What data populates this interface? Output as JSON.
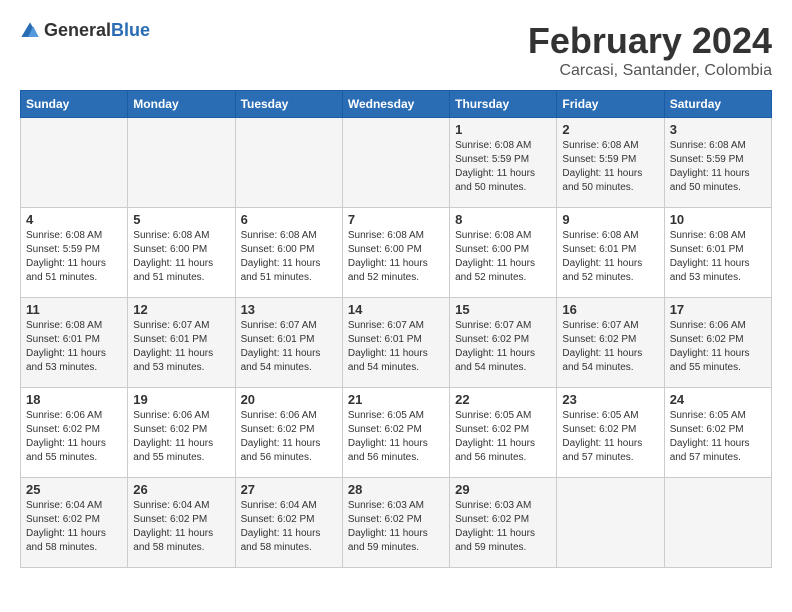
{
  "logo": {
    "general": "General",
    "blue": "Blue"
  },
  "header": {
    "month": "February 2024",
    "location": "Carcasi, Santander, Colombia"
  },
  "weekdays": [
    "Sunday",
    "Monday",
    "Tuesday",
    "Wednesday",
    "Thursday",
    "Friday",
    "Saturday"
  ],
  "weeks": [
    [
      {
        "day": "",
        "info": ""
      },
      {
        "day": "",
        "info": ""
      },
      {
        "day": "",
        "info": ""
      },
      {
        "day": "",
        "info": ""
      },
      {
        "day": "1",
        "info": "Sunrise: 6:08 AM\nSunset: 5:59 PM\nDaylight: 11 hours and 50 minutes."
      },
      {
        "day": "2",
        "info": "Sunrise: 6:08 AM\nSunset: 5:59 PM\nDaylight: 11 hours and 50 minutes."
      },
      {
        "day": "3",
        "info": "Sunrise: 6:08 AM\nSunset: 5:59 PM\nDaylight: 11 hours and 50 minutes."
      }
    ],
    [
      {
        "day": "4",
        "info": "Sunrise: 6:08 AM\nSunset: 5:59 PM\nDaylight: 11 hours and 51 minutes."
      },
      {
        "day": "5",
        "info": "Sunrise: 6:08 AM\nSunset: 6:00 PM\nDaylight: 11 hours and 51 minutes."
      },
      {
        "day": "6",
        "info": "Sunrise: 6:08 AM\nSunset: 6:00 PM\nDaylight: 11 hours and 51 minutes."
      },
      {
        "day": "7",
        "info": "Sunrise: 6:08 AM\nSunset: 6:00 PM\nDaylight: 11 hours and 52 minutes."
      },
      {
        "day": "8",
        "info": "Sunrise: 6:08 AM\nSunset: 6:00 PM\nDaylight: 11 hours and 52 minutes."
      },
      {
        "day": "9",
        "info": "Sunrise: 6:08 AM\nSunset: 6:01 PM\nDaylight: 11 hours and 52 minutes."
      },
      {
        "day": "10",
        "info": "Sunrise: 6:08 AM\nSunset: 6:01 PM\nDaylight: 11 hours and 53 minutes."
      }
    ],
    [
      {
        "day": "11",
        "info": "Sunrise: 6:08 AM\nSunset: 6:01 PM\nDaylight: 11 hours and 53 minutes."
      },
      {
        "day": "12",
        "info": "Sunrise: 6:07 AM\nSunset: 6:01 PM\nDaylight: 11 hours and 53 minutes."
      },
      {
        "day": "13",
        "info": "Sunrise: 6:07 AM\nSunset: 6:01 PM\nDaylight: 11 hours and 54 minutes."
      },
      {
        "day": "14",
        "info": "Sunrise: 6:07 AM\nSunset: 6:01 PM\nDaylight: 11 hours and 54 minutes."
      },
      {
        "day": "15",
        "info": "Sunrise: 6:07 AM\nSunset: 6:02 PM\nDaylight: 11 hours and 54 minutes."
      },
      {
        "day": "16",
        "info": "Sunrise: 6:07 AM\nSunset: 6:02 PM\nDaylight: 11 hours and 54 minutes."
      },
      {
        "day": "17",
        "info": "Sunrise: 6:06 AM\nSunset: 6:02 PM\nDaylight: 11 hours and 55 minutes."
      }
    ],
    [
      {
        "day": "18",
        "info": "Sunrise: 6:06 AM\nSunset: 6:02 PM\nDaylight: 11 hours and 55 minutes."
      },
      {
        "day": "19",
        "info": "Sunrise: 6:06 AM\nSunset: 6:02 PM\nDaylight: 11 hours and 55 minutes."
      },
      {
        "day": "20",
        "info": "Sunrise: 6:06 AM\nSunset: 6:02 PM\nDaylight: 11 hours and 56 minutes."
      },
      {
        "day": "21",
        "info": "Sunrise: 6:05 AM\nSunset: 6:02 PM\nDaylight: 11 hours and 56 minutes."
      },
      {
        "day": "22",
        "info": "Sunrise: 6:05 AM\nSunset: 6:02 PM\nDaylight: 11 hours and 56 minutes."
      },
      {
        "day": "23",
        "info": "Sunrise: 6:05 AM\nSunset: 6:02 PM\nDaylight: 11 hours and 57 minutes."
      },
      {
        "day": "24",
        "info": "Sunrise: 6:05 AM\nSunset: 6:02 PM\nDaylight: 11 hours and 57 minutes."
      }
    ],
    [
      {
        "day": "25",
        "info": "Sunrise: 6:04 AM\nSunset: 6:02 PM\nDaylight: 11 hours and 58 minutes."
      },
      {
        "day": "26",
        "info": "Sunrise: 6:04 AM\nSunset: 6:02 PM\nDaylight: 11 hours and 58 minutes."
      },
      {
        "day": "27",
        "info": "Sunrise: 6:04 AM\nSunset: 6:02 PM\nDaylight: 11 hours and 58 minutes."
      },
      {
        "day": "28",
        "info": "Sunrise: 6:03 AM\nSunset: 6:02 PM\nDaylight: 11 hours and 59 minutes."
      },
      {
        "day": "29",
        "info": "Sunrise: 6:03 AM\nSunset: 6:02 PM\nDaylight: 11 hours and 59 minutes."
      },
      {
        "day": "",
        "info": ""
      },
      {
        "day": "",
        "info": ""
      }
    ]
  ]
}
